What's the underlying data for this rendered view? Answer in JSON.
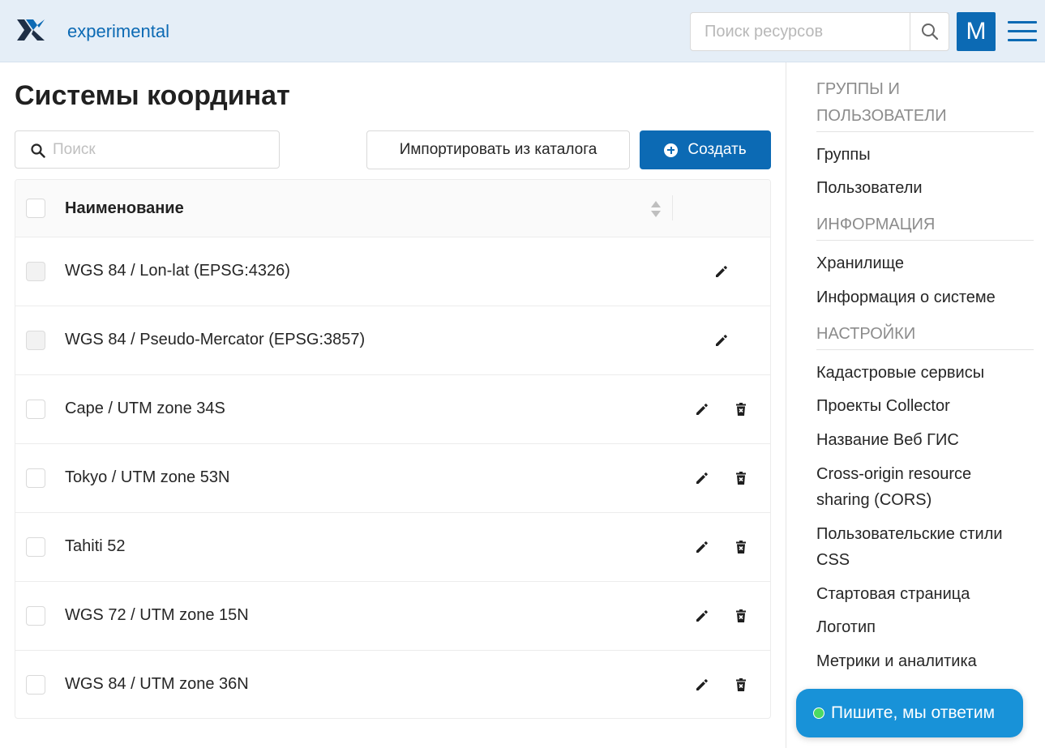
{
  "header": {
    "app_name": "experimental",
    "search_placeholder": "Поиск ресурсов",
    "avatar_letter": "M"
  },
  "main": {
    "title": "Системы координат",
    "filter_placeholder": "Поиск",
    "import_label": "Импортировать из каталога",
    "create_label": "Создать",
    "table": {
      "column_name": "Наименование",
      "rows": [
        {
          "name": "WGS 84 / Lon-lat (EPSG:4326)",
          "deletable": false
        },
        {
          "name": "WGS 84 / Pseudo-Mercator (EPSG:3857)",
          "deletable": false
        },
        {
          "name": "Cape / UTM zone 34S",
          "deletable": true
        },
        {
          "name": "Tokyo / UTM zone 53N",
          "deletable": true
        },
        {
          "name": "Tahiti 52",
          "deletable": true
        },
        {
          "name": "WGS 72 / UTM zone 15N",
          "deletable": true
        },
        {
          "name": "WGS 84 / UTM zone 36N",
          "deletable": true
        }
      ]
    }
  },
  "sidebar": {
    "sections": [
      {
        "title": "ГРУППЫ И ПОЛЬЗОВАТЕЛИ",
        "items": [
          "Группы",
          "Пользователи"
        ]
      },
      {
        "title": "ИНФОРМАЦИЯ",
        "items": [
          "Хранилище",
          "Информация о системе"
        ]
      },
      {
        "title": "НАСТРОЙКИ",
        "items": [
          "Кадастровые сервисы",
          "Проекты Collector",
          "Название Веб ГИС",
          "Cross-origin resource sharing (CORS)",
          "Пользовательские стили CSS",
          "Стартовая страница",
          "Логотип",
          "Метрики и аналитика"
        ]
      }
    ]
  },
  "chat": {
    "label": "Пишите, мы ответим"
  },
  "colors": {
    "brand": "#0c6ab4",
    "header_bg": "#e5eef7",
    "chat": "#1892d8",
    "online": "#4cd964"
  }
}
